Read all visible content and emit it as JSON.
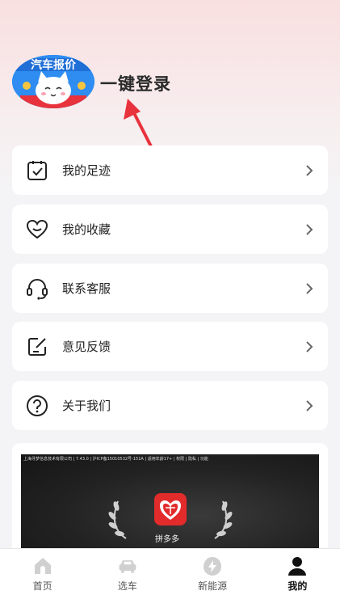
{
  "profile": {
    "avatar_banner_text": "汽车报价",
    "login_label": "一键登录"
  },
  "menu": [
    {
      "label": "我的足迹",
      "icon": "footprint-icon"
    },
    {
      "label": "我的收藏",
      "icon": "heart-icon"
    },
    {
      "label": "联系客服",
      "icon": "headset-icon"
    },
    {
      "label": "意见反馈",
      "icon": "feedback-icon"
    },
    {
      "label": "关于我们",
      "icon": "question-icon"
    }
  ],
  "ad": {
    "info_line": "上海寻梦信息技术有限公司 | 7.43.0 | 沪ICP备15010532号-151A | 适用年龄17+ | 权限 | 隐私 | 功能",
    "app_name": "拼多多",
    "brand_color": "#e22b2b"
  },
  "tabbar": [
    {
      "label": "首页",
      "icon": "home-icon",
      "active": false
    },
    {
      "label": "选车",
      "icon": "car-icon",
      "active": false
    },
    {
      "label": "新能源",
      "icon": "lightning-icon",
      "active": false
    },
    {
      "label": "我的",
      "icon": "user-icon",
      "active": true
    }
  ],
  "colors": {
    "accent_arrow": "#e8323c",
    "text_primary": "#222222"
  }
}
